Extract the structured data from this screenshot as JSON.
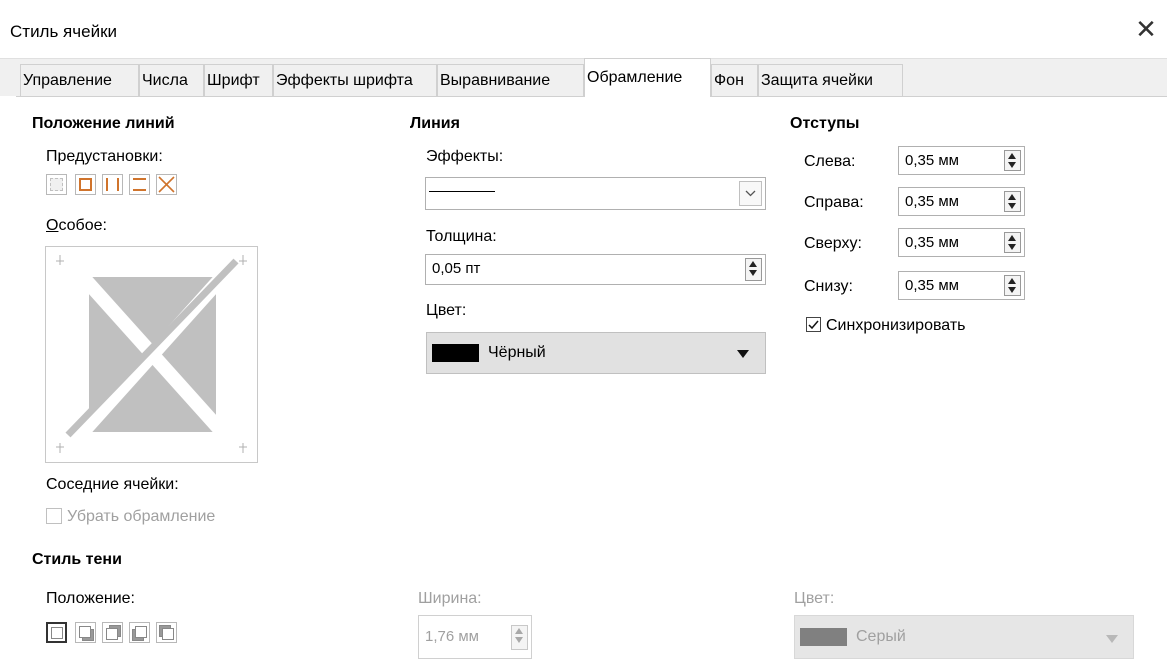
{
  "window": {
    "title": "Стиль ячейки"
  },
  "tabs": [
    {
      "label": "Управление"
    },
    {
      "label": "Числа"
    },
    {
      "label": "Шрифт"
    },
    {
      "label": "Эффекты шрифта"
    },
    {
      "label": "Выравнивание"
    },
    {
      "label": "Обрамление",
      "active": true
    },
    {
      "label": "Фон"
    },
    {
      "label": "Защита ячейки"
    }
  ],
  "lines_position": {
    "heading": "Положение линий",
    "presets_label": "Предустановки:",
    "custom_label": "Особое:",
    "adjacent_label": "Соседние ячейки:",
    "remove_border_label": "Убрать обрамление"
  },
  "line": {
    "heading": "Линия",
    "effects_label": "Эффекты:",
    "thickness_label": "Толщина:",
    "thickness_value": "0,05 пт",
    "color_label": "Цвет:",
    "color_value": "Чёрный",
    "color_hex": "#000000"
  },
  "padding": {
    "heading": "Отступы",
    "left_label": "Слева:",
    "left_value": "0,35 мм",
    "right_label": "Справа:",
    "right_value": "0,35 мм",
    "top_label": "Сверху:",
    "top_value": "0,35 мм",
    "bottom_label": "Снизу:",
    "bottom_value": "0,35 мм",
    "sync_label": "Синхронизировать",
    "sync_checked": true
  },
  "shadow": {
    "heading": "Стиль тени",
    "position_label": "Положение:",
    "width_label": "Ширина:",
    "width_value": "1,76 мм",
    "color_label": "Цвет:",
    "color_value": "Серый",
    "color_hex": "#808080"
  },
  "colors": {
    "preset_orange": "#d0742c",
    "frame_gray": "#c0c0c0"
  }
}
